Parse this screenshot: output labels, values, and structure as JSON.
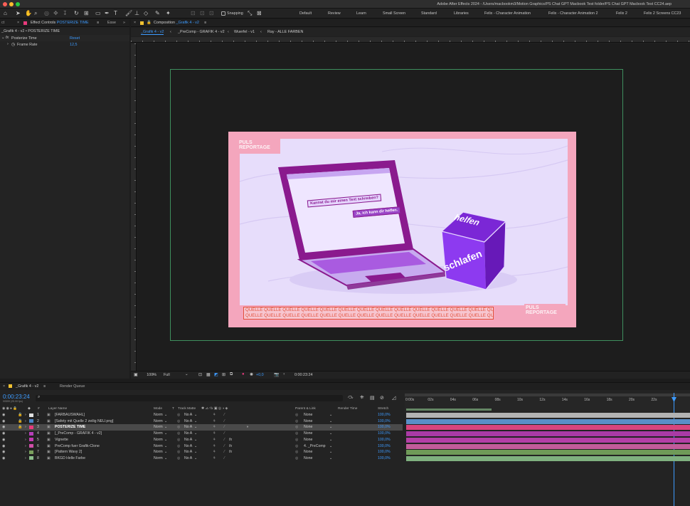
{
  "app": {
    "title": "Adobe After Effects 2024 - /Users/macbookm3/Motion Graphics/PS Chat GPT Macbook Test folder/PS Chat GPT Macbook Test CC24.aep"
  },
  "toolbar": {
    "snapping": "Snapping",
    "workspaces": [
      "Default",
      "Review",
      "Learn",
      "Small Screen",
      "Standard",
      "Libraries",
      "Felix - Character Animation",
      "Felix - Character Animation 2",
      "Felix 2",
      "Felix 2 Screens CC23"
    ]
  },
  "effect_controls": {
    "tab_prefix": "ct",
    "tab_label": "Effect Controls",
    "tab_layer": "POSTERIZE TIME",
    "next_tab": "Esse",
    "breadcrumb": "_Grafik 4 - v2 • POSTERIZE TIME",
    "effect_name": "Posterize Time",
    "reset_label": "Reset",
    "param_name": "Frame Rate",
    "param_value": "12,5"
  },
  "composition": {
    "tab_label": "Composition",
    "tab_name": "_Grafik 4 - v2",
    "breadcrumbs": [
      "_Grafik 4 - v2",
      "_PreComp - GRAFIK 4 - v2",
      "Wuerfel - v1",
      "Ray - ALLE FARBEN"
    ],
    "zoom": "100%",
    "resolution": "Full",
    "exposure": "+0,0",
    "timecode": "0:00:23:24",
    "art": {
      "logo_line1": "PULS",
      "logo_line2": "REPORTAGE",
      "screen_text1": "Kannst du mir einen Text schreiben?",
      "screen_text2": "Ja, ich kann dir helfen.",
      "cube_top": "helfen",
      "cube_side": "schlafen",
      "quelle_line1": "QUELLE QUELLE QUELLE QUELLE QUELLE QUELLE QUELLE QUELLE QUELLE QUELLE QUELLE QUELLE QUELLE QUELLE",
      "quelle_line2": "QUELLE QUELLE QUELLE QUELLE QUELLE QUELLE QUELLE QUELLE QUELLE QUELLE QUELLE QUELLE QUELLE QUELLE"
    }
  },
  "timeline": {
    "tab_label": "_Grafik 4 - v2",
    "render_queue": "Render Queue",
    "timecode": "0:00:23:24",
    "frames": "00599 (25.00 fps)",
    "search_placeholder": "",
    "headers": {
      "num": "#",
      "layer_name": "Layer Name",
      "mode": "Mode",
      "t": "T",
      "track_matte": "Track Matte",
      "parent": "Parent & Link",
      "render_time": "Render Time",
      "stretch": "Stretch"
    },
    "ruler": [
      "0:00s",
      "02s",
      "04s",
      "06s",
      "08s",
      "10s",
      "12s",
      "14s",
      "16s",
      "18s",
      "20s",
      "22s"
    ],
    "layers": [
      {
        "num": "1",
        "name": "[FARBAUSWAHL]",
        "mode": "Norm",
        "matte": "No A",
        "parent": "None",
        "stretch": "100,0%",
        "color": "#e0e0e0",
        "bar": "#b3b3b3"
      },
      {
        "num": "2",
        "name": "[Safety mit Quelle 2 zeilig NEU.png]",
        "mode": "Norm",
        "matte": "No A",
        "parent": "None",
        "stretch": "100,0%",
        "color": "#4a86c8",
        "bar": "#5a8fc7"
      },
      {
        "num": "3",
        "name": "POSTERIZE TIME",
        "mode": "Norm",
        "matte": "No A",
        "parent": "None",
        "stretch": "100,0%",
        "color": "#e83a7c",
        "bar": "#d8457d"
      },
      {
        "num": "4",
        "name": "[_PreComp - GRAFIK 4 - v2]",
        "mode": "Norm",
        "matte": "No A",
        "parent": "None",
        "stretch": "100,0%",
        "color": "#b53fb7",
        "bar": "#a93aa5"
      },
      {
        "num": "5",
        "name": "Vignette",
        "mode": "Norm",
        "matte": "No A",
        "parent": "None",
        "stretch": "100,0%",
        "color": "#c33ab2",
        "bar": "#b43fa6"
      },
      {
        "num": "6",
        "name": "PreComp fuer Grafik-Clone",
        "mode": "Norm",
        "matte": "No A",
        "parent": "4. _PreComp",
        "stretch": "100,0%",
        "color": "#d04fa8",
        "bar": "#c25c9a"
      },
      {
        "num": "7",
        "name": "[Pattern Wavy 2]",
        "mode": "Norm",
        "matte": "No A",
        "parent": "None",
        "stretch": "100,0%",
        "color": "#7aa05d",
        "bar": "#6f9a58"
      },
      {
        "num": "8",
        "name": "BKGD Helle Farbe",
        "mode": "Norm",
        "matte": "No A",
        "parent": "None",
        "stretch": "100,0%",
        "color": "#8bbf8b",
        "bar": "#7fb07f"
      }
    ]
  }
}
